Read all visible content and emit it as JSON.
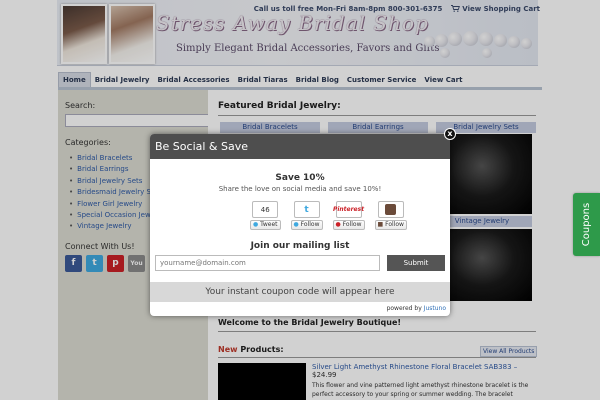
{
  "header": {
    "logo_title": "Stress Away Bridal Shop",
    "logo_subtitle": "Simply Elegant Bridal Accessories, Favors and Gifts",
    "phone_text": "Call us toll free Mon-Fri 8am-8pm 800-301-6375",
    "cart_link": "View Shopping Cart"
  },
  "nav": {
    "items": [
      "Home",
      "Bridal Jewelry",
      "Bridal Accessories",
      "Bridal Tiaras",
      "Bridal Blog",
      "Customer Service",
      "View Cart"
    ],
    "active": "Home"
  },
  "sidebar": {
    "search_heading": "Search:",
    "search_value": "",
    "categories_heading": "Categories:",
    "categories": [
      "Bridal Bracelets",
      "Bridal Earrings",
      "Bridal Jewelry Sets",
      "Bridesmaid Jewelry Sets",
      "Flower Girl Jewelry",
      "Special Occasion Jewelry",
      "Vintage Jewelry"
    ],
    "connect_heading": "Connect With Us!",
    "social_icons": [
      "facebook-icon",
      "twitter-icon",
      "pinterest-icon",
      "youtube-icon"
    ]
  },
  "main": {
    "featured_title": "Featured Bridal Jewelry:",
    "category_tabs": [
      "Bridal Bracelets",
      "Bridal Earrings",
      "Bridal Jewelry Sets"
    ],
    "vintage_tab": "Vintage Jewelry",
    "welcome_title": "Welcome to the Bridal Jewelry Boutique!",
    "new_word": "New",
    "products_word": "Products:",
    "view_all": "View All Products",
    "product": {
      "title": "Silver Light Amethyst Rhinestone Floral Bracelet SAB383 –",
      "price": "$24.99",
      "description": "This flower and vine patterned light amethyst rhinestone bracelet is the perfect accessory to your spring or summer wedding. The bracelet"
    }
  },
  "modal": {
    "title": "Be Social & Save",
    "close_label": "x",
    "save_heading": "Save 10%",
    "save_subtext": "Share the love on social media and save 10%!",
    "share_count": "46",
    "tweet_label": "Tweet",
    "follow_label_1": "Follow",
    "pinterest_label": "Pinterest",
    "follow_label_2": "Follow",
    "follow_label_3": "Follow",
    "mailing_heading": "Join our mailing list",
    "email_placeholder": "yourname@domain.com",
    "submit_label": "Submit",
    "coupon_text": "Your instant coupon code will appear here",
    "powered_by": "powered by",
    "powered_brand": "Justuno"
  },
  "side_tab": {
    "label": "Coupons"
  },
  "colors": {
    "accent_blue": "#2e5aa6",
    "modal_header": "#4e4e4e",
    "coupons_green": "#2e9a4a",
    "new_red": "#c0392b"
  }
}
